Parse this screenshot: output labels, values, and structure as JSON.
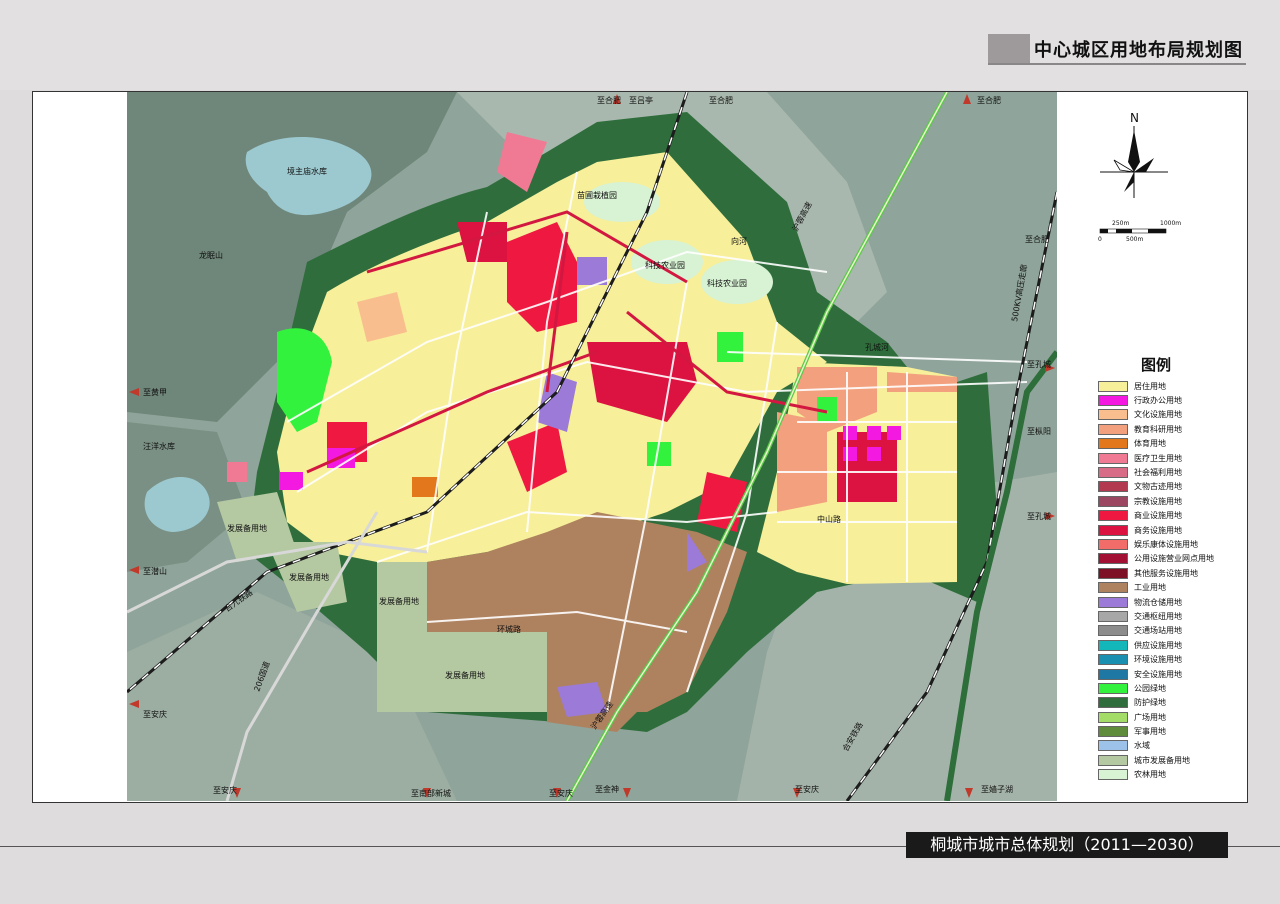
{
  "map_title": "中心城区用地布局规划图",
  "footer_title": "桐城市城市总体规划（2011—2030）",
  "north_label": "N",
  "scale": {
    "labels": [
      "250m",
      "1000m",
      "0",
      "500m"
    ]
  },
  "legend": {
    "title": "图例",
    "items": [
      {
        "label": "居住用地",
        "color": "#f7ef9a"
      },
      {
        "label": "行政办公用地",
        "color": "#f319e0"
      },
      {
        "label": "文化设施用地",
        "color": "#f8be8e"
      },
      {
        "label": "教育科研用地",
        "color": "#f2a07d"
      },
      {
        "label": "体育用地",
        "color": "#e2771c"
      },
      {
        "label": "医疗卫生用地",
        "color": "#f07a93"
      },
      {
        "label": "社会福利用地",
        "color": "#d86c87"
      },
      {
        "label": "文物古迹用地",
        "color": "#b2394f"
      },
      {
        "label": "宗教设施用地",
        "color": "#9c4762"
      },
      {
        "label": "商业设施用地",
        "color": "#ee1841"
      },
      {
        "label": "商务设施用地",
        "color": "#dc1240"
      },
      {
        "label": "娱乐康体设施用地",
        "color": "#f26d6a"
      },
      {
        "label": "公用设施营业网点用地",
        "color": "#a21133"
      },
      {
        "label": "其他服务设施用地",
        "color": "#7e1026"
      },
      {
        "label": "工业用地",
        "color": "#ae825f"
      },
      {
        "label": "物流仓储用地",
        "color": "#9c7ad8"
      },
      {
        "label": "交通枢纽用地",
        "color": "#a7a7a7"
      },
      {
        "label": "交通场站用地",
        "color": "#8c8c8c"
      },
      {
        "label": "供应设施用地",
        "color": "#13b6b9"
      },
      {
        "label": "环境设施用地",
        "color": "#1a8fb0"
      },
      {
        "label": "安全设施用地",
        "color": "#1f78a4"
      },
      {
        "label": "公园绿地",
        "color": "#33f23e"
      },
      {
        "label": "防护绿地",
        "color": "#2f6e3c"
      },
      {
        "label": "广场用地",
        "color": "#a3dc67"
      },
      {
        "label": "军事用地",
        "color": "#5f8c3b"
      },
      {
        "label": "水域",
        "color": "#9cc2ea"
      },
      {
        "label": "城市发展备用地",
        "color": "#b4c8a1"
      },
      {
        "label": "农林用地",
        "color": "#d8f2d4"
      }
    ]
  },
  "place_labels": {
    "reservoir_north": "境主庙水库",
    "mountain": "龙眠山",
    "reservoir_west": "汪洋水库",
    "nursery": "苗圃栽植园",
    "agri_park_1": "科技农业园",
    "agri_park_2": "科技农业园",
    "river_xiang": "向河",
    "river_kong": "孔城河",
    "reserve_1": "发展备用地",
    "reserve_2": "发展备用地",
    "reserve_3": "发展备用地",
    "reserve_4": "发展备用地",
    "expressway_1": "沪蓉高速",
    "expressway_2": "沪蓉高速",
    "railway_1": "合九铁路",
    "railway_2": "合安铁路",
    "line_500kv": "500KV高压走廊",
    "road_206": "206国道",
    "road_mid": "中山路",
    "road_ring": "环城路"
  },
  "direction_labels": {
    "n_lvting": "至吕亭",
    "n_hefei_1": "至合肥",
    "n_hefei_2": "至合肥",
    "n_hefei_3": "至合肥",
    "n_hefei_4": "至合肥",
    "e_kongcheng_1": "至孔城",
    "e_kongcheng_2": "至孔城",
    "e_zongyang": "至枞阳",
    "w_huangjia": "至黄甲",
    "w_qianshan": "至潜山",
    "w_anqing": "至安庆",
    "s_anqing_1": "至安庆",
    "s_nanbu": "至南部新城",
    "s_anqing_2": "至安庆",
    "s_jinshen": "至金神",
    "s_anqing_3": "至安庆",
    "s_gaizihu": "至嫱子湖"
  }
}
